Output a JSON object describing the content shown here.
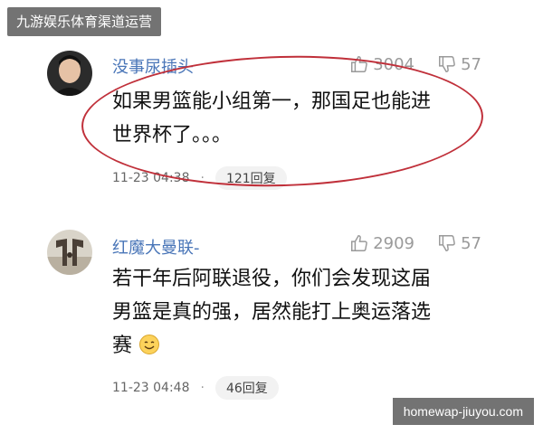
{
  "watermark_top": "九游娱乐体育渠道运营",
  "watermark_bottom": "homewap-jiuyou.com",
  "comments": [
    {
      "username": "没事尿插头",
      "likes": "3004",
      "dislikes": "57",
      "text_line1": "如果男篮能小组第一，那国足也能进",
      "text_line2": "世界杯了。。。",
      "time": "11-23 04:38",
      "replies": "121回复"
    },
    {
      "username": "红魔大曼联-",
      "likes": "2909",
      "dislikes": "57",
      "text_line1": "若干年后阿联退役，你们会发现这届",
      "text_line2": "男篮是真的强，居然能打上奥运落选",
      "text_line3": "赛",
      "emoji": "smile-emoji",
      "time": "11-23 04:48",
      "replies": "46回复"
    }
  ],
  "colors": {
    "username": "#4a76b8",
    "annotation_circle": "#c0303a"
  }
}
